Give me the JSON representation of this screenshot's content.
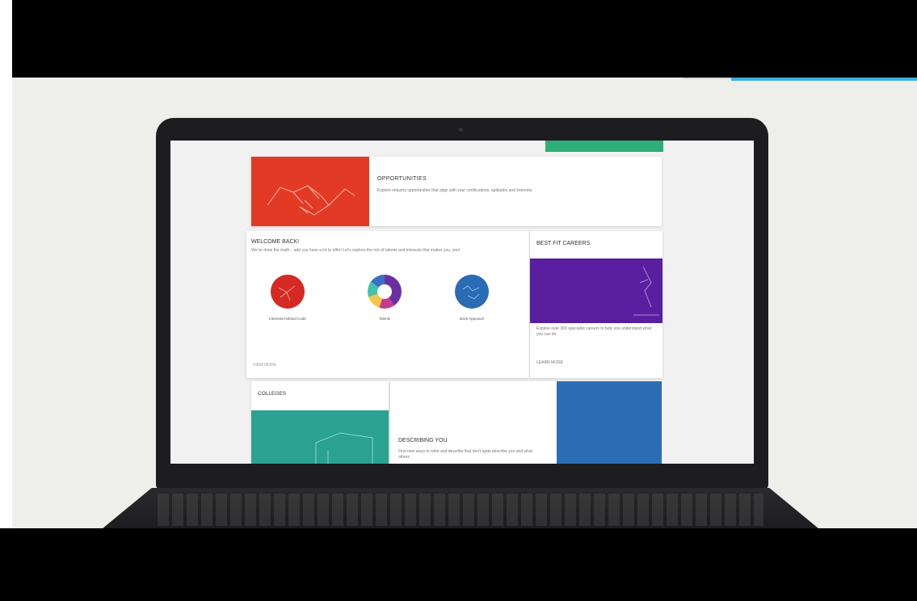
{
  "screen": {
    "opportunities": {
      "title": "OPPORTUNITIES",
      "description": "Explore industry opportunities that align with your certifications, aptitudes and interests."
    },
    "welcome": {
      "title": "WELCOME BACK!",
      "description": "We’ve done the math... add you have a lot to offer! Let’s explore the mix of talents and interests that makes you, you!",
      "circles": [
        {
          "label": "Interests/Holland Code"
        },
        {
          "label": "Talents"
        },
        {
          "label": "Work Approach"
        }
      ],
      "link": "VIEW MORE"
    },
    "best_fit": {
      "title": "BEST FIT CAREERS",
      "description": "Explore over 300 specialist careers to help you understand what you can be.",
      "link": "LEARN MORE"
    },
    "colleges": {
      "title": "COLLEGES"
    },
    "describing": {
      "title": "DESCRIBING YOU",
      "description": "Find new ways to write and describe that don't quite describe you and what others"
    }
  },
  "colors": {
    "opportunities_image": "#e33a25",
    "best_fit_image": "#5a1fa0",
    "colleges_image": "#2aa193",
    "blue_block": "#2b6db5",
    "green_strip": "#2fae77",
    "top_accent": "#3bb0e3"
  },
  "icons": [
    "handshake-icon",
    "network-icon",
    "donut-icon",
    "globe-icon",
    "microscope-icon",
    "house-icon"
  ]
}
